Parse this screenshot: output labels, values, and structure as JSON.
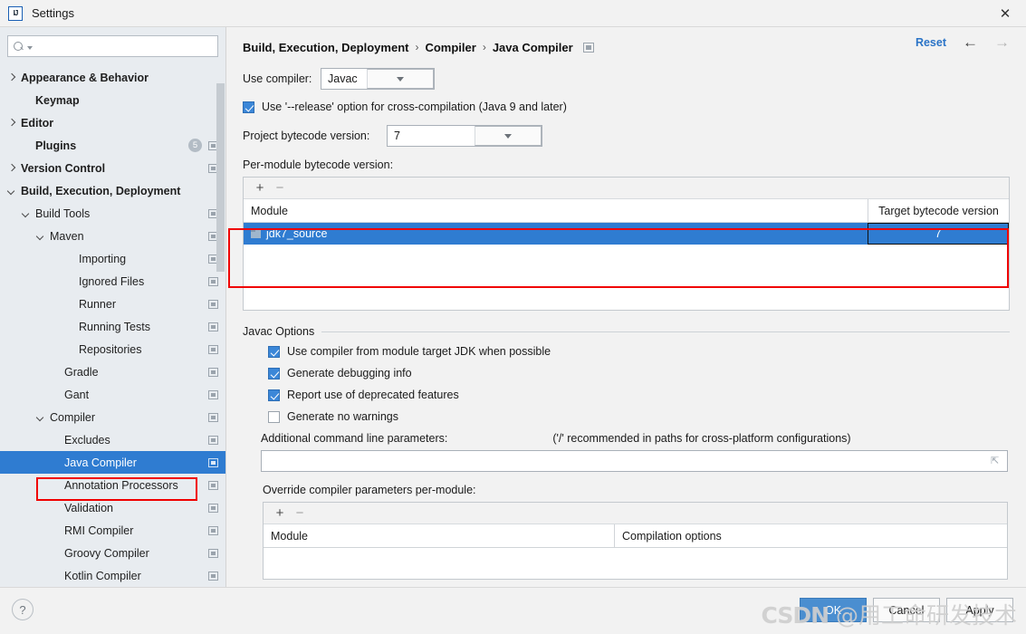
{
  "window": {
    "title": "Settings",
    "logo_icon": "intellij-idea-logo-icon",
    "close_icon": "close-icon"
  },
  "search": {
    "value": "",
    "placeholder": "",
    "icon": "search-icon",
    "caret_icon": "chevron-down-icon"
  },
  "sidebar": {
    "items": [
      {
        "label": "Appearance & Behavior",
        "indent": 0,
        "arrow": "collapsed",
        "bold": true,
        "badge": "",
        "mini": false,
        "selected": false
      },
      {
        "label": "Keymap",
        "indent": 1,
        "arrow": "none",
        "bold": true,
        "badge": "",
        "mini": false,
        "selected": false
      },
      {
        "label": "Editor",
        "indent": 0,
        "arrow": "collapsed",
        "bold": true,
        "badge": "",
        "mini": false,
        "selected": false
      },
      {
        "label": "Plugins",
        "indent": 1,
        "arrow": "none",
        "bold": true,
        "badge": "5",
        "mini": true,
        "selected": false
      },
      {
        "label": "Version Control",
        "indent": 0,
        "arrow": "collapsed",
        "bold": true,
        "badge": "",
        "mini": true,
        "selected": false
      },
      {
        "label": "Build, Execution, Deployment",
        "indent": 0,
        "arrow": "expanded",
        "bold": true,
        "badge": "",
        "mini": false,
        "selected": false
      },
      {
        "label": "Build Tools",
        "indent": 1,
        "arrow": "expanded",
        "bold": false,
        "badge": "",
        "mini": true,
        "selected": false
      },
      {
        "label": "Maven",
        "indent": 2,
        "arrow": "expanded",
        "bold": false,
        "badge": "",
        "mini": true,
        "selected": false
      },
      {
        "label": "Importing",
        "indent": 4,
        "arrow": "none",
        "bold": false,
        "badge": "",
        "mini": true,
        "selected": false
      },
      {
        "label": "Ignored Files",
        "indent": 4,
        "arrow": "none",
        "bold": false,
        "badge": "",
        "mini": true,
        "selected": false
      },
      {
        "label": "Runner",
        "indent": 4,
        "arrow": "none",
        "bold": false,
        "badge": "",
        "mini": true,
        "selected": false
      },
      {
        "label": "Running Tests",
        "indent": 4,
        "arrow": "none",
        "bold": false,
        "badge": "",
        "mini": true,
        "selected": false
      },
      {
        "label": "Repositories",
        "indent": 4,
        "arrow": "none",
        "bold": false,
        "badge": "",
        "mini": true,
        "selected": false
      },
      {
        "label": "Gradle",
        "indent": 3,
        "arrow": "none",
        "bold": false,
        "badge": "",
        "mini": true,
        "selected": false
      },
      {
        "label": "Gant",
        "indent": 3,
        "arrow": "none",
        "bold": false,
        "badge": "",
        "mini": true,
        "selected": false
      },
      {
        "label": "Compiler",
        "indent": 2,
        "arrow": "expanded",
        "bold": false,
        "badge": "",
        "mini": true,
        "selected": false
      },
      {
        "label": "Excludes",
        "indent": 3,
        "arrow": "none",
        "bold": false,
        "badge": "",
        "mini": true,
        "selected": false
      },
      {
        "label": "Java Compiler",
        "indent": 3,
        "arrow": "none",
        "bold": false,
        "badge": "",
        "mini": true,
        "selected": true
      },
      {
        "label": "Annotation Processors",
        "indent": 3,
        "arrow": "none",
        "bold": false,
        "badge": "",
        "mini": true,
        "selected": false
      },
      {
        "label": "Validation",
        "indent": 3,
        "arrow": "none",
        "bold": false,
        "badge": "",
        "mini": true,
        "selected": false
      },
      {
        "label": "RMI Compiler",
        "indent": 3,
        "arrow": "none",
        "bold": false,
        "badge": "",
        "mini": true,
        "selected": false
      },
      {
        "label": "Groovy Compiler",
        "indent": 3,
        "arrow": "none",
        "bold": false,
        "badge": "",
        "mini": true,
        "selected": false
      },
      {
        "label": "Kotlin Compiler",
        "indent": 3,
        "arrow": "none",
        "bold": false,
        "badge": "",
        "mini": true,
        "selected": false
      }
    ]
  },
  "header": {
    "breadcrumbs": [
      "Build, Execution, Deployment",
      "Compiler",
      "Java Compiler"
    ],
    "separator": "›",
    "reset_label": "Reset",
    "back_icon": "arrow-left-icon",
    "forward_icon": "arrow-right-icon"
  },
  "main": {
    "use_compiler_label": "Use compiler:",
    "use_compiler_value": "Javac",
    "release_option_label": "Use '--release' option for cross-compilation (Java 9 and later)",
    "release_option_checked": true,
    "project_bytecode_label": "Project bytecode version:",
    "project_bytecode_value": "7",
    "per_module_label": "Per-module bytecode version:",
    "add_icon": "plus-icon",
    "remove_icon": "minus-icon",
    "module_table": {
      "columns": [
        "Module",
        "Target bytecode version"
      ],
      "rows": [
        {
          "module": "jdk7_source",
          "version": "7",
          "selected": true
        }
      ]
    },
    "javac_group_title": "Javac Options",
    "javac_options": [
      {
        "label": "Use compiler from module target JDK when possible",
        "checked": true
      },
      {
        "label": "Generate debugging info",
        "checked": true
      },
      {
        "label": "Report use of deprecated features",
        "checked": true
      },
      {
        "label": "Generate no warnings",
        "checked": false
      }
    ],
    "additional_params_label": "Additional command line parameters:",
    "additional_params_hint": "('/' recommended in paths for cross-platform configurations)",
    "additional_params_value": "",
    "expand_icon": "expand-icon",
    "override_label": "Override compiler parameters per-module:",
    "override_table": {
      "columns": [
        "Module",
        "Compilation options"
      ],
      "rows": []
    }
  },
  "footer": {
    "help_icon": "help-icon",
    "ok_label": "OK",
    "cancel_label": "Cancel",
    "apply_label": "Apply"
  },
  "watermark": {
    "csdn": "CSDN",
    "handle": "@用工命研发技术"
  },
  "annotations": {
    "color": "#f00000"
  }
}
